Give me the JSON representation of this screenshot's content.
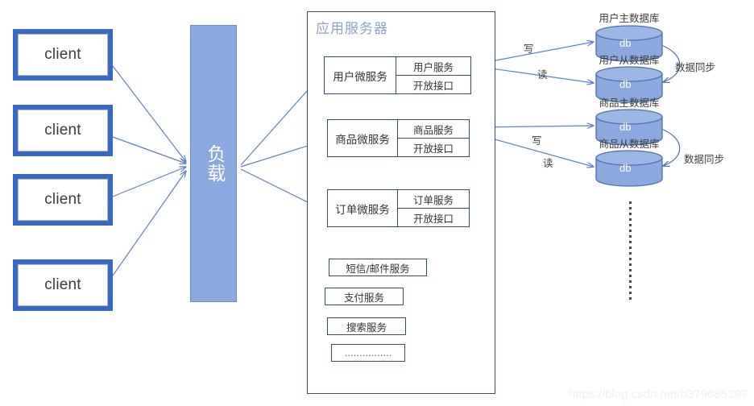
{
  "diagram": {
    "title_app_server": "应用服务器",
    "watermark": "https://blog.csdn.net/b379685397",
    "colors": {
      "client_border": "#3A69C4",
      "load_balancer_fill": "#8BA9DE",
      "app_server_border": "#2E4C7E",
      "arrow": "#5B83C4",
      "db_fill": "#8BA9DE",
      "db_stroke": "#4A6FAF",
      "title_text": "#8DA2C8"
    }
  },
  "clients": [
    {
      "label": "client"
    },
    {
      "label": "client"
    },
    {
      "label": "client"
    },
    {
      "label": "client"
    }
  ],
  "load_balancer": {
    "label": "负载"
  },
  "microservices": [
    {
      "name": "用户微服务",
      "sub": [
        "用户服务",
        "开放接口"
      ]
    },
    {
      "name": "商品微服务",
      "sub": [
        "商品服务",
        "开放接口"
      ]
    },
    {
      "name": "订单微服务",
      "sub": [
        "订单服务",
        "开放接口"
      ]
    }
  ],
  "support_services": [
    {
      "label": "短信/邮件服务"
    },
    {
      "label": "支付服务"
    },
    {
      "label": "搜索服务"
    },
    {
      "label": "……………."
    }
  ],
  "databases": [
    {
      "master_label": "用户主数据库",
      "slave_label": "用户从数据库",
      "node_text": "db",
      "write_label": "写",
      "read_label": "读",
      "sync_label": "数据同步"
    },
    {
      "master_label": "商品主数据库",
      "slave_label": "商品从数据库",
      "node_text": "db",
      "write_label": "写",
      "read_label": "读",
      "sync_label": "数据同步"
    }
  ]
}
